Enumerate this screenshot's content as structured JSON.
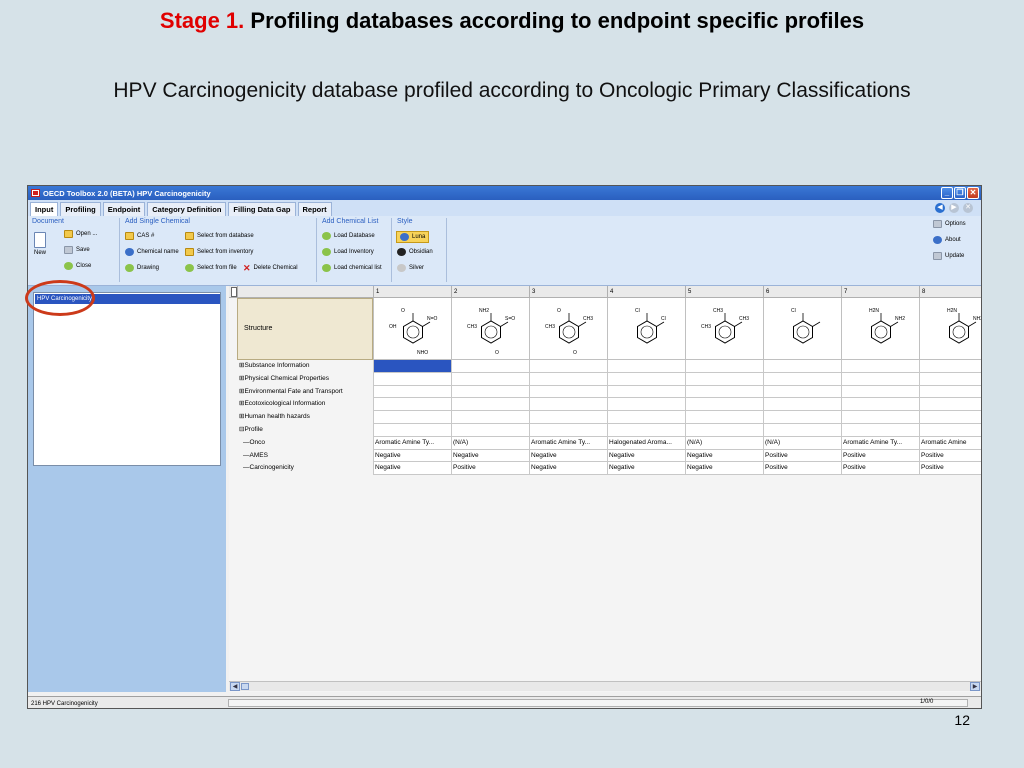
{
  "slide": {
    "title_stage": "Stage 1.",
    "title_rest": "Profiling databases according to endpoint specific profiles",
    "subtitle": "HPV Carcinogenicity database profiled according to Oncologic Primary Classifications",
    "page_number": "12"
  },
  "window": {
    "title": "OECD Toolbox 2.0 (BETA)  HPV Carcinogenicity",
    "buttons": [
      "_",
      "❐",
      "✕"
    ]
  },
  "tabs": [
    "Input",
    "Profiling",
    "Endpoint",
    "Category Definition",
    "Filling Data Gap",
    "Report"
  ],
  "ribbon": {
    "document": {
      "label": "Document",
      "new": "New",
      "open": "Open ...",
      "save": "Save",
      "close": "Close"
    },
    "add_single": {
      "label": "Add Single Chemical",
      "cas": "CAS #",
      "chemical_name": "Chemical name",
      "drawing": "Drawing",
      "select_database": "Select from database",
      "select_inventory": "Select from inventory",
      "select_file": "Select from file",
      "delete": "Delete Chemical"
    },
    "add_list": {
      "label": "Add Chemical List",
      "load_database": "Load Database",
      "load_inventory": "Load Inventory",
      "load_list": "Load chemical list"
    },
    "style": {
      "label": "Style",
      "luna": "Luna",
      "obsidian": "Obsidian",
      "silver": "Silver"
    },
    "right": {
      "options": "Options",
      "about": "About",
      "update": "Update"
    }
  },
  "tree": {
    "selected": "HPV Carcinogenicity"
  },
  "grid": {
    "columns": [
      "1",
      "2",
      "3",
      "4",
      "5",
      "6",
      "7",
      "8"
    ],
    "structure_label": "Structure",
    "molecule_labels": [
      {
        "a": "O",
        "b": "N=O",
        "c": "OH",
        "d": "NHO"
      },
      {
        "a": "NH2",
        "b": "S=O",
        "c": "CH3",
        "d": "O"
      },
      {
        "a": "O",
        "b": "CH3",
        "c": "CH3",
        "d": "O"
      },
      {
        "a": "Cl",
        "b": "Cl",
        "c": "",
        "d": ""
      },
      {
        "a": "CH3",
        "b": "CH3",
        "c": "CH3",
        "d": ""
      },
      {
        "a": "Cl",
        "b": "",
        "c": "",
        "d": ""
      },
      {
        "a": "H2N",
        "b": "NH2",
        "c": "",
        "d": ""
      },
      {
        "a": "H2N",
        "b": "NH2",
        "c": "",
        "d": ""
      }
    ],
    "property_rows": [
      "⊞Substance Information",
      "⊞Physical Chemical Properties",
      "⊞Environmental Fate and Transport",
      "⊞Ecotoxicological Information",
      "⊞Human health hazards",
      "⊟Profile"
    ],
    "profile_rows": [
      {
        "label": "—Onco",
        "values": [
          "Aromatic Amine Ty...",
          "(N/A)",
          "Aromatic Amine Ty...",
          "Halogenated Aroma...",
          "(N/A)",
          "(N/A)",
          "Aromatic Amine Ty...",
          "Aromatic Amine"
        ]
      },
      {
        "label": "—AMES",
        "values": [
          "Negative",
          "Negative",
          "Negative",
          "Negative",
          "Negative",
          "Positive",
          "Positive",
          "Positive"
        ]
      },
      {
        "label": "—Carcinogenicity",
        "values": [
          "Negative",
          "Positive",
          "Negative",
          "Negative",
          "Negative",
          "Positive",
          "Positive",
          "Positive"
        ]
      }
    ]
  },
  "status": {
    "left": "216  HPV Carcinogenicity",
    "right": "1/0/0"
  },
  "colors": {
    "stage_red": "#e00000",
    "selection_blue": "#2a55c0",
    "annotation_red": "#cc3a1a"
  }
}
